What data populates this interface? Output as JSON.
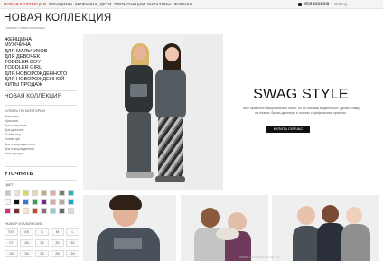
{
  "topnav": {
    "items": [
      {
        "label": "Новая коллекция",
        "active": true
      },
      {
        "label": "Женщины",
        "active": false
      },
      {
        "label": "Мужчина",
        "active": false
      },
      {
        "label": "Дети",
        "active": false
      },
      {
        "label": "Промоакции",
        "active": false
      },
      {
        "label": "Магазины",
        "active": false
      },
      {
        "label": "Журнал",
        "active": false
      }
    ],
    "cart_label": "Моя корзина",
    "login_label": "Я Вход"
  },
  "page": {
    "title": "НОВАЯ КОЛЛЕКЦИЯ",
    "breadcrumb": "Главная \\ новая коллекция"
  },
  "sidebar": {
    "categories": [
      "Женщина",
      "Мужчина",
      "Для мальчиков",
      "Для девочек",
      "Toddler boy",
      "Toddler girl",
      "Для новорожденного",
      "Для новорожденной",
      "Хиты продаж"
    ],
    "section_title": "НОВАЯ КОЛЛЕКЦИЯ",
    "filter_header": "КУПИТЬ ПО КАТЕГОРИИ",
    "filter_items": [
      "Женщина",
      "Мужчина",
      "Для мальчиков",
      "Для девочек",
      "Toddler boy",
      "Toddler girl",
      "Для новорожденного",
      "Для новорожденной",
      "Хиты продаж"
    ],
    "refine_title": "УТОЧНИТЬ",
    "color_label": "ЦВЕТ",
    "colors": [
      "#c8c8c8",
      "#e9e3cf",
      "#e7d54c",
      "#f1d2a5",
      "#c0ab7c",
      "#e8a99e",
      "#7b7b7b",
      "#2bb0c4",
      "#f6f6f6",
      "#111111",
      "#3b79d0",
      "#35a14f",
      "#6f2c8f",
      "#d7aaa3",
      "#b8a9a1",
      "#17a6d1",
      "#d92f7a",
      "#7a2f2e",
      "#f4e8cf",
      "#d54128",
      "#8d6a7d",
      "#93c9d6",
      "#6a6a6a",
      "#e2ddd3"
    ],
    "size_label": "РАЗМЕР ИТАЛЬЯНСКИЙ",
    "sizes": [
      "TXT",
      "XS",
      "S",
      "M",
      "L",
      "27",
      "28",
      "29",
      "30",
      "31",
      "26",
      "26",
      "26",
      "26",
      "26"
    ]
  },
  "hero": {
    "title": "SWAG STYLE",
    "description": "Тебе нравится неформальный стиль, но ты любишь выделяться? Делай ставку на платье, брюки-джоггеры и лосины с графическим принтом.",
    "button_label": "КУПИТЬ СЕЙЧАС"
  },
  "watermark": "www.shopsofficial.ru"
}
